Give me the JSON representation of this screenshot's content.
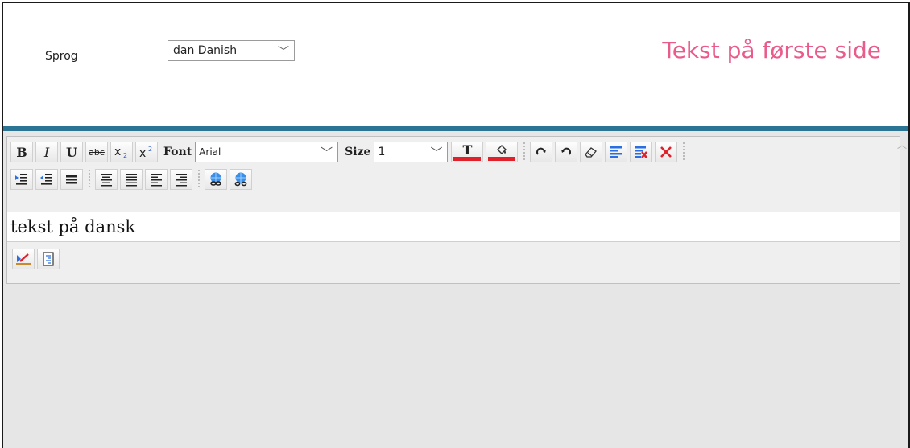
{
  "header": {
    "language_label": "Sprog",
    "language_value": "dan Danish",
    "page_title": "Tekst på første side"
  },
  "toolbar": {
    "bold": "B",
    "italic": "I",
    "underline": "U",
    "strike": "abc",
    "font_label": "Font",
    "font_value": "Arial",
    "size_label": "Size",
    "size_value": "1",
    "text_color_glyph": "T"
  },
  "editor": {
    "content": "tekst på dansk"
  },
  "colors": {
    "title_pink": "#ea5a8a",
    "accent_blue": "#2b7494",
    "color_swatch_red": "#e0202a"
  }
}
